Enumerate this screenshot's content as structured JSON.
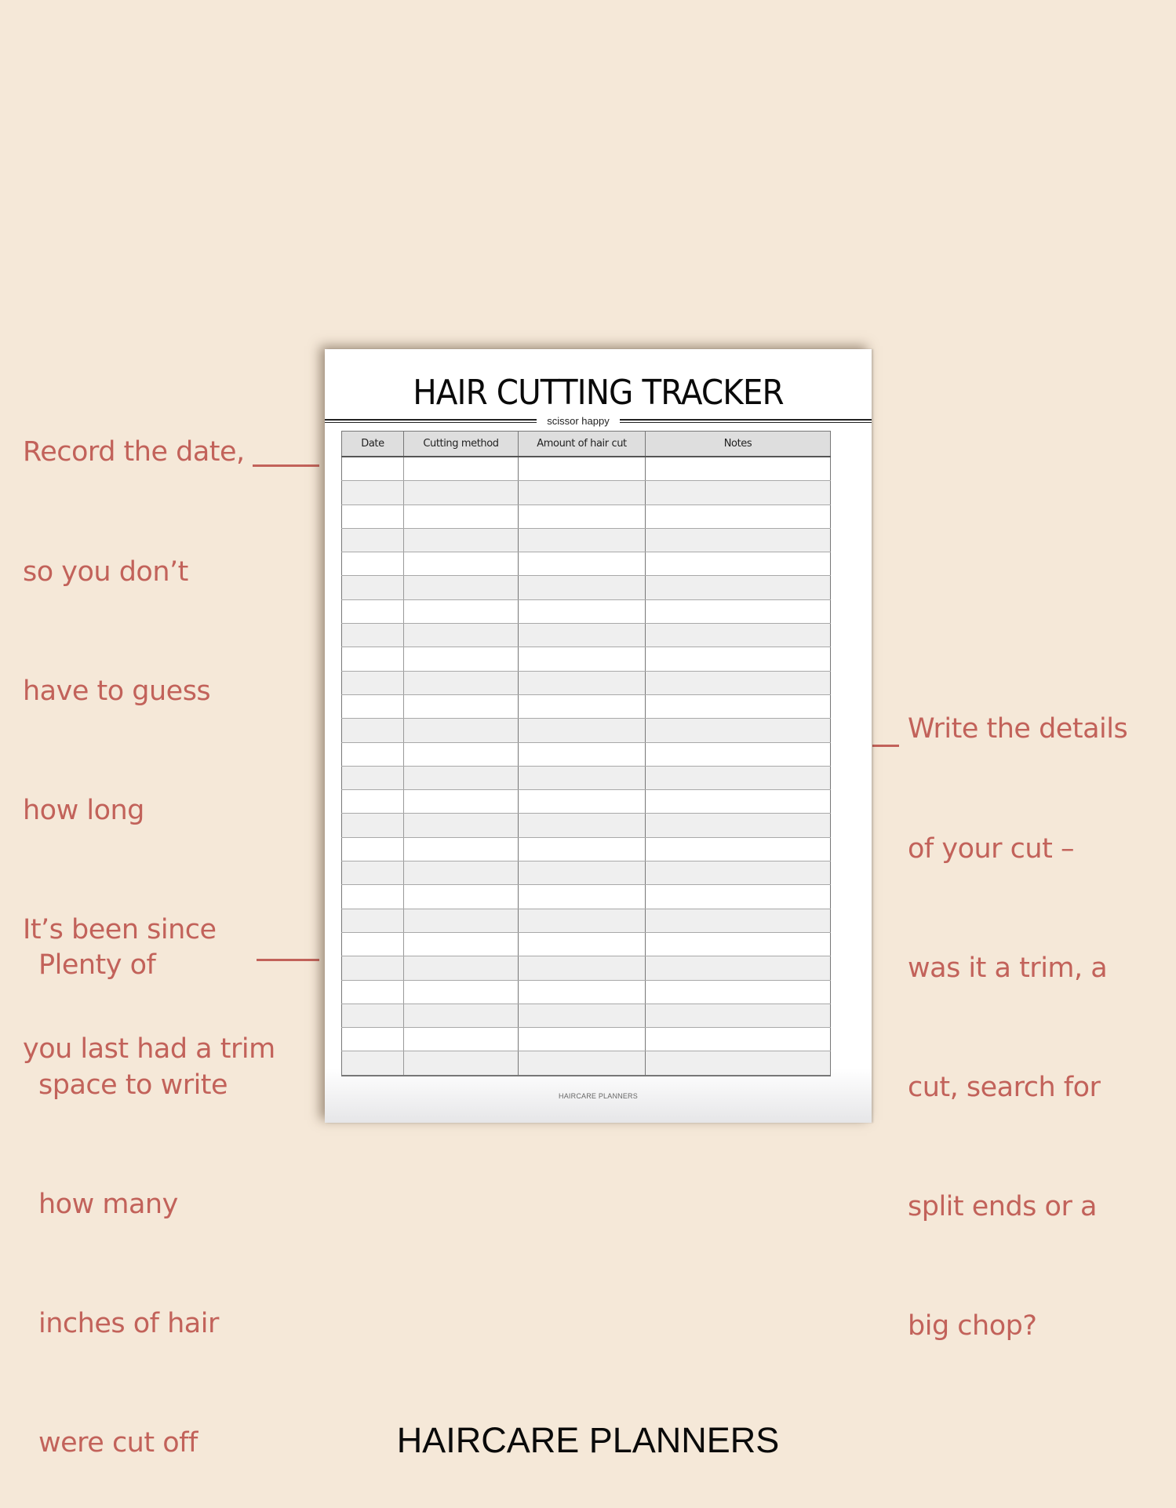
{
  "annotations": {
    "date_note": {
      "lines": [
        "Record the date,",
        "so you don’t",
        "have to guess",
        "how long",
        "It’s been since",
        "you last had a trim"
      ]
    },
    "details_note": {
      "lines": [
        "Write the details",
        "of your cut –",
        "was it a trim, a",
        "cut, search for",
        "split ends or a",
        "big chop?"
      ]
    },
    "amount_note": {
      "lines": [
        "Plenty of",
        "space to write",
        "how many",
        "inches of hair",
        "were cut off"
      ]
    }
  },
  "colors": {
    "background": "#f5e8d8",
    "annotation": "#c2625a",
    "header_fill": "#dedede",
    "alt_row_fill": "#efefef"
  },
  "page": {
    "title": "HAIR CUTTING TRACKER",
    "subtitle": "scissor happy",
    "footer": "HAIRCARE PLANNERS",
    "table": {
      "columns": [
        "Date",
        "Cutting method",
        "Amount of hair cut",
        "Notes"
      ],
      "row_count": 26
    }
  },
  "brand": "HAIRCARE PLANNERS"
}
